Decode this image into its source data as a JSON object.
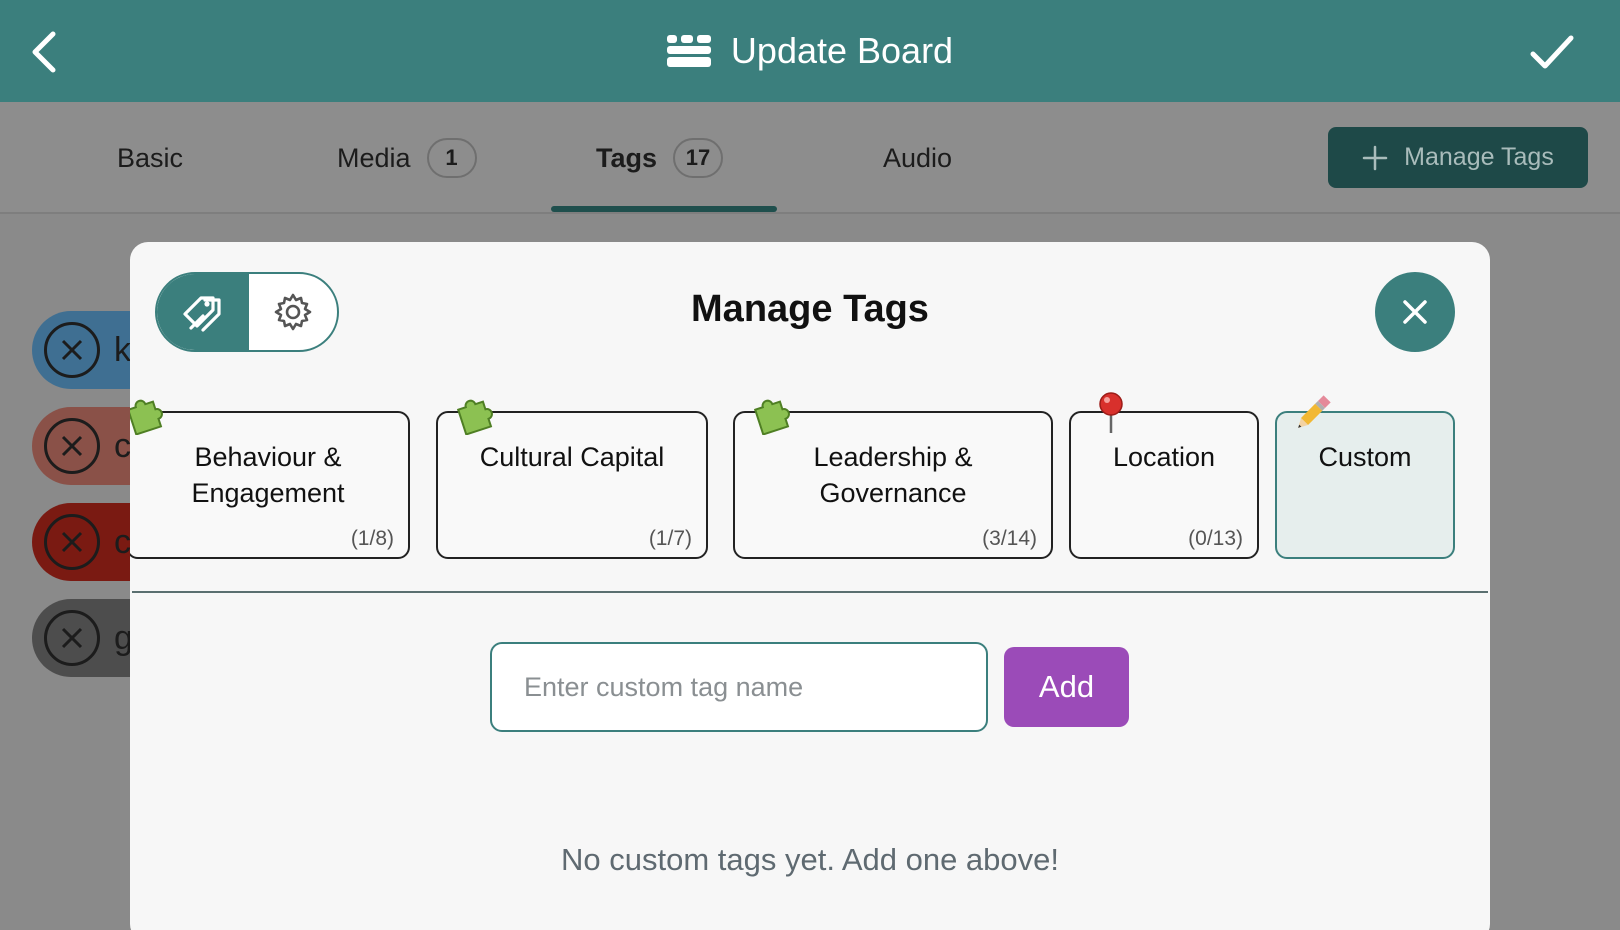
{
  "header": {
    "title": "Update Board",
    "back_icon": "chevron-left-icon",
    "board_icon": "board-icon",
    "confirm_icon": "checkmark-icon"
  },
  "tabs": [
    {
      "label": "Basic",
      "badge": ""
    },
    {
      "label": "Media",
      "badge": "1"
    },
    {
      "label": "Tags",
      "badge": "17",
      "active": true
    },
    {
      "label": "Audio",
      "badge": ""
    }
  ],
  "manage_tags_button": {
    "label": "Manage Tags",
    "icon": "plus-icon"
  },
  "background_chips": [
    {
      "text": "k",
      "color": "#3f6f92"
    },
    {
      "text": "c",
      "color": "#8a5148"
    },
    {
      "text": "c",
      "color": "#7a1a12"
    },
    {
      "text": "g",
      "color": "#4d4d4d"
    }
  ],
  "modal": {
    "title": "Manage Tags",
    "segment": {
      "left_icon": "tag-icon",
      "right_icon": "gear-icon"
    },
    "close_icon": "close-icon",
    "categories": [
      {
        "name_line1": "Behaviour &",
        "name_line2": "Engagement",
        "count": "(1/8)",
        "icon": "puzzle-icon"
      },
      {
        "name_line1": "Cultural Capital",
        "name_line2": "",
        "count": "(1/7)",
        "icon": "puzzle-icon"
      },
      {
        "name_line1": "Leadership &",
        "name_line2": "Governance",
        "count": "(3/14)",
        "icon": "puzzle-icon"
      },
      {
        "name_line1": "Location",
        "name_line2": "",
        "count": "(0/13)",
        "icon": "pushpin-icon"
      },
      {
        "name_line1": "Custom",
        "name_line2": "",
        "count": "",
        "icon": "pencil-icon",
        "selected": true
      }
    ],
    "custom_input": {
      "placeholder": "Enter custom tag name",
      "value": ""
    },
    "add_label": "Add",
    "empty_message": "No custom tags yet. Add one above!"
  },
  "colors": {
    "teal": "#3b7f7d",
    "dark_teal": "#1e4948",
    "purple": "#9b4bb8"
  }
}
